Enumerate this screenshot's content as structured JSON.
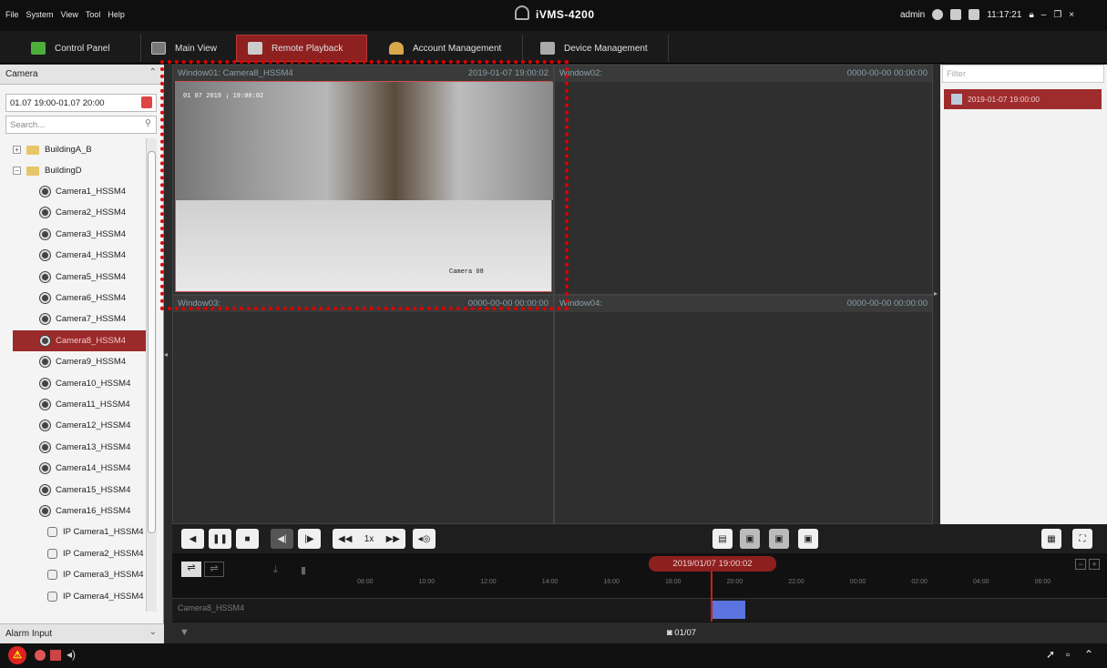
{
  "menu": [
    "File",
    "System",
    "View",
    "Tool",
    "Help"
  ],
  "app_title": "iVMS-4200",
  "user": {
    "name": "admin",
    "time": "11:17:21"
  },
  "tabs": [
    {
      "label": "Control Panel"
    },
    {
      "label": "Main View"
    },
    {
      "label": "Remote Playback"
    },
    {
      "label": "Account Management"
    },
    {
      "label": "Device Management"
    }
  ],
  "left": {
    "header": "Camera",
    "date_range": "01.07 19:00-01.07 20:00",
    "search_placeholder": "Search...",
    "groups": [
      "BuildingA_B",
      "BuildingD"
    ],
    "cameras": [
      "Camera1_HSSM4",
      "Camera2_HSSM4",
      "Camera3_HSSM4",
      "Camera4_HSSM4",
      "Camera5_HSSM4",
      "Camera6_HSSM4",
      "Camera7_HSSM4",
      "Camera8_HSSM4",
      "Camera9_HSSM4",
      "Camera10_HSSM4",
      "Camera11_HSSM4",
      "Camera12_HSSM4",
      "Camera13_HSSM4",
      "Camera14_HSSM4",
      "Camera15_HSSM4",
      "Camera16_HSSM4"
    ],
    "ip_cameras": [
      "IP Camera1_HSSM4",
      "IP Camera2_HSSM4",
      "IP Camera3_HSSM4",
      "IP Camera4_HSSM4"
    ],
    "alarm_header": "Alarm Input"
  },
  "windows": [
    {
      "title": "Window01: Camera8_HSSM4",
      "time": "2019-01-07 19:00:02"
    },
    {
      "title": "Window02:",
      "time": "0000-00-00 00:00:00"
    },
    {
      "title": "Window03:",
      "time": "0000-00-00 00:00:00"
    },
    {
      "title": "Window04:",
      "time": "0000-00-00 00:00:00"
    }
  ],
  "osd": {
    "datetime": "01 07 2019 ¡   19:00:02",
    "cam": "Camera 08"
  },
  "right": {
    "filter_placeholder": "Filter",
    "record": "2019-01-07 19:00:00"
  },
  "controls": {
    "speed": "1x"
  },
  "timeline": {
    "current": "2019/01/07 19:00:02",
    "ticks": [
      "08:00",
      "10:00",
      "12:00",
      "14:00",
      "16:00",
      "18:00",
      "20:00",
      "22:00",
      "00:00",
      "02:00",
      "04:00",
      "06:00"
    ],
    "camera": "Camera8_HSSM4",
    "date": "01/07"
  },
  "colors": {
    "accent": "#9b2a2a",
    "record_block": "#5b74e0"
  }
}
